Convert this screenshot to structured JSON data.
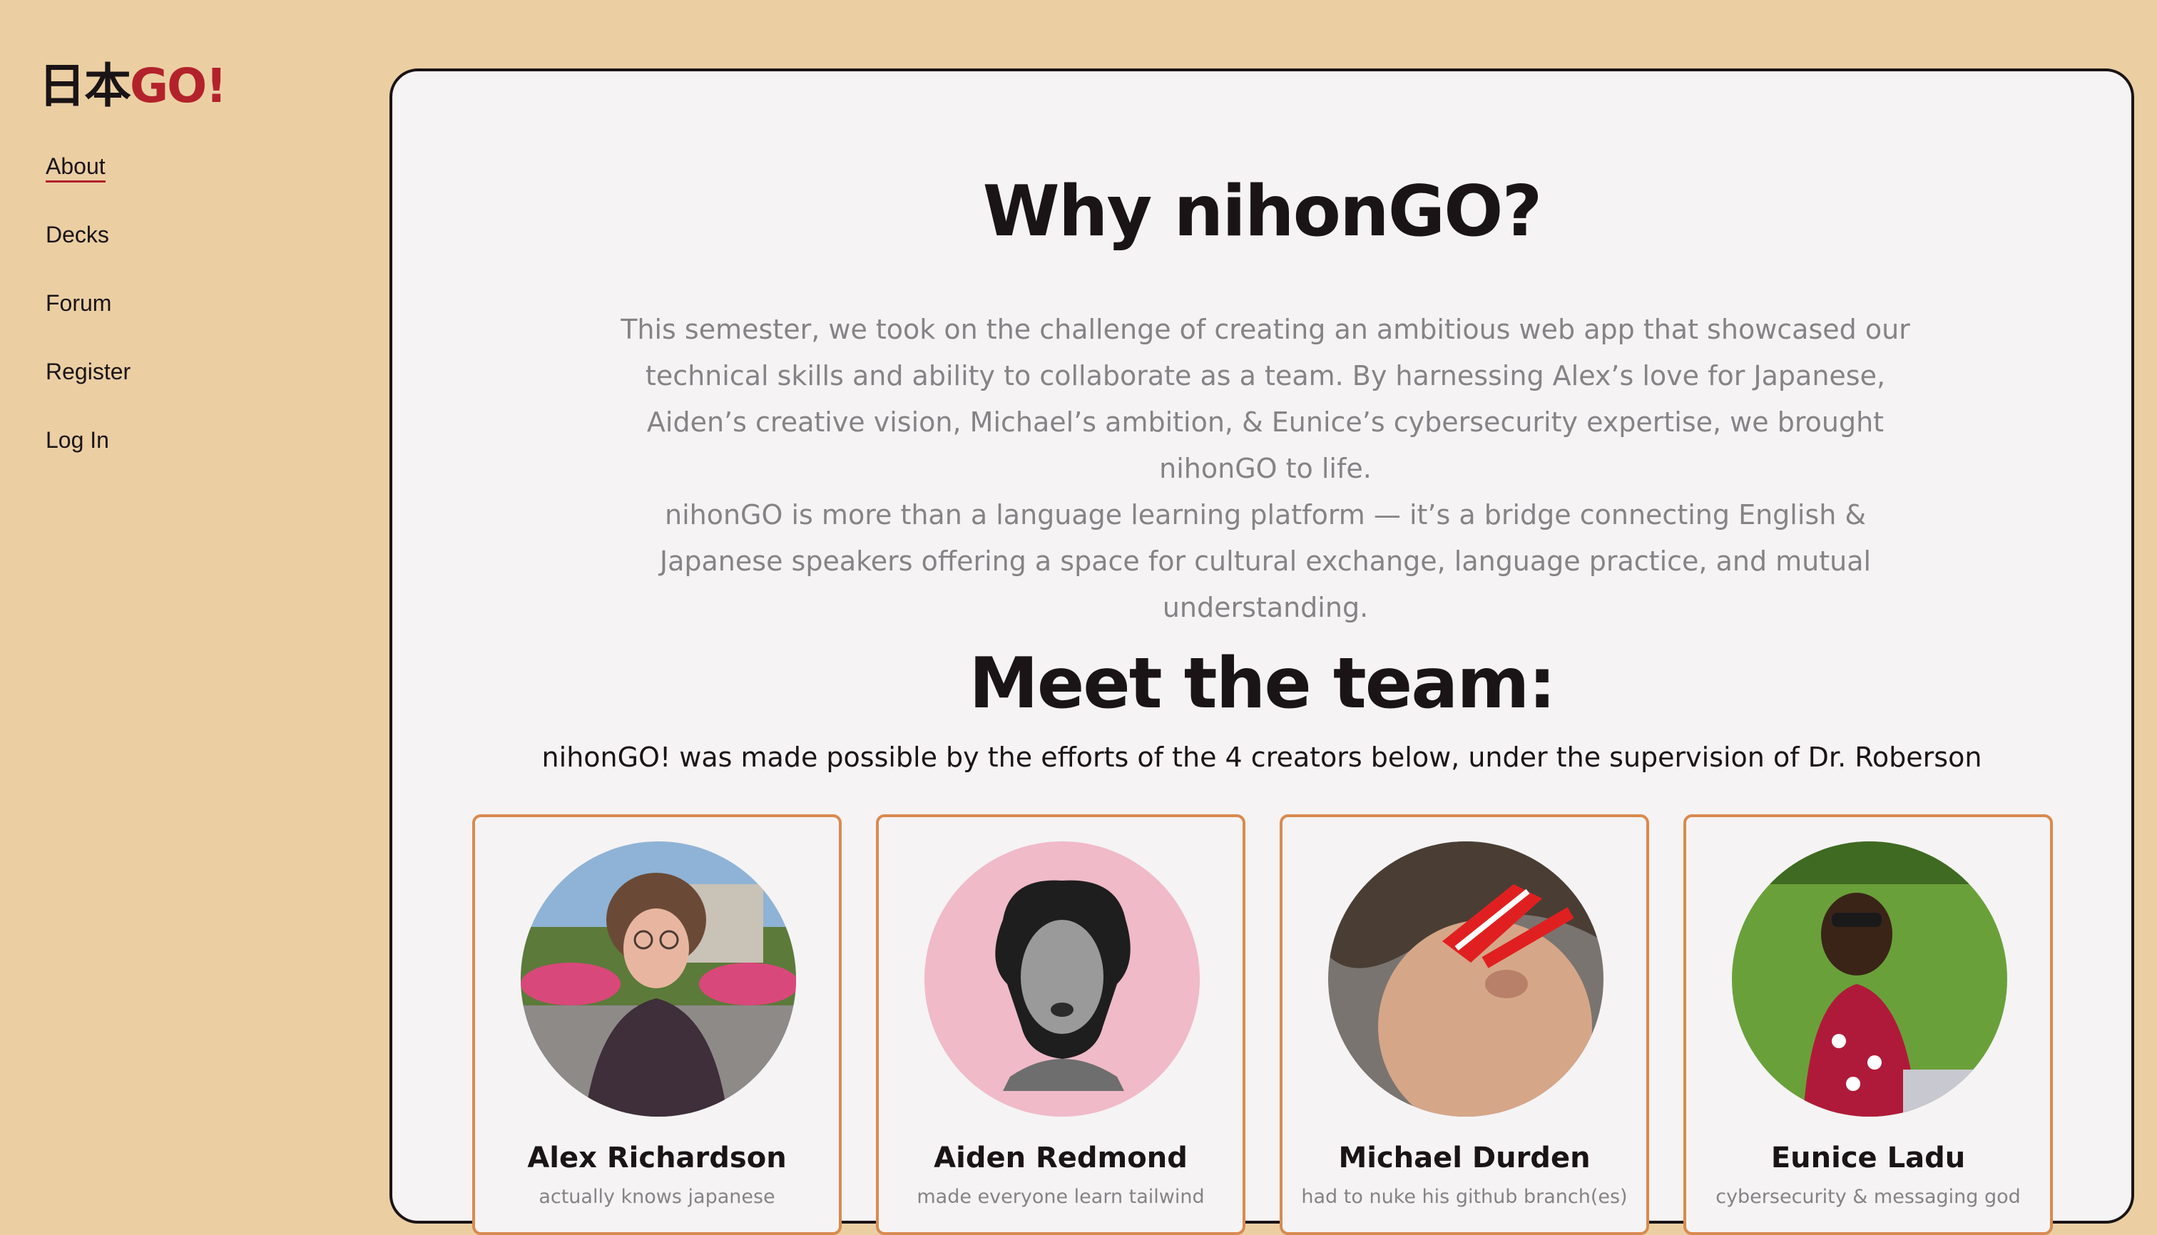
{
  "brand": {
    "kanji": "日本",
    "go": "GO!"
  },
  "nav": {
    "items": [
      {
        "label": "About",
        "active": true
      },
      {
        "label": "Decks"
      },
      {
        "label": "Forum"
      },
      {
        "label": "Register"
      },
      {
        "label": "Log In"
      }
    ]
  },
  "about": {
    "title": "Why nihonGO?",
    "paragraph1": "This semester, we took on the challenge of creating an ambitious web app that showcased our technical skills and ability to collaborate as a team. By harnessing Alex’s love for Japanese, Aiden’s creative vision, Michael’s ambition, & Eunice’s cybersecurity expertise, we brought nihonGO to life.",
    "paragraph2": "nihonGO is more than a language learning platform — it’s a bridge connecting English & Japanese speakers offering a space for cultural exchange, language practice, and mutual understanding."
  },
  "team": {
    "title": "Meet the team:",
    "subtitle": "nihonGO! was made possible by the efforts of the 4 creators below, under the supervision of Dr. Roberson",
    "members": [
      {
        "name": "Alex Richardson",
        "role": "actually knows japanese"
      },
      {
        "name": "Aiden Redmond",
        "role": "made everyone learn tailwind"
      },
      {
        "name": "Michael Durden",
        "role": "had to nuke his github branch(es)"
      },
      {
        "name": "Eunice Ladu",
        "role": "cybersecurity & messaging god"
      }
    ]
  },
  "colors": {
    "page_bg": "#ebcfa3",
    "card_bg": "#f5f3f4",
    "accent_red": "#b3222b",
    "card_border_orange": "#d98a4f",
    "text_dark": "#1a1416",
    "text_muted": "#858385"
  }
}
